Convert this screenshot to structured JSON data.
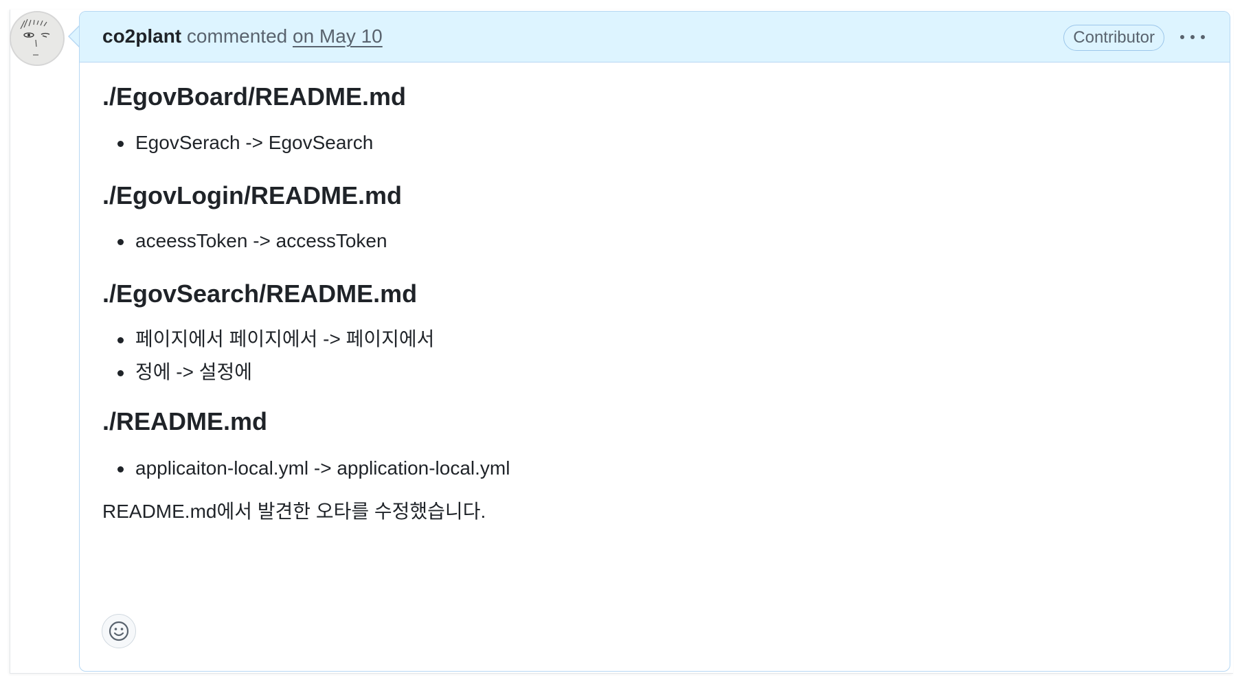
{
  "comment": {
    "author": "co2plant",
    "action": "commented",
    "date": "on May 10",
    "badge": "Contributor",
    "more_icon": "kebab-horizontal-icon"
  },
  "sections": [
    {
      "heading": "./EgovBoard/README.md",
      "items": [
        "EgovSerach -> EgovSearch"
      ]
    },
    {
      "heading": "./EgovLogin/README.md",
      "items": [
        "aceessToken -> accessToken"
      ]
    },
    {
      "heading": "./EgovSearch/README.md",
      "items": [
        "페이지에서 페이지에서 -> 페이지에서",
        "정에 -> 설정에"
      ]
    },
    {
      "heading": "./README.md",
      "items": [
        "applicaiton-local.yml -> application-local.yml"
      ]
    }
  ],
  "closing_text": "README.md에서 발견한 오타를 수정했습니다.",
  "reactions": {
    "icon": "smiley-icon"
  },
  "colors": {
    "header_bg": "#ddf4ff",
    "header_border": "#b6d7f3",
    "text": "#1f2328",
    "muted": "#59636e"
  }
}
